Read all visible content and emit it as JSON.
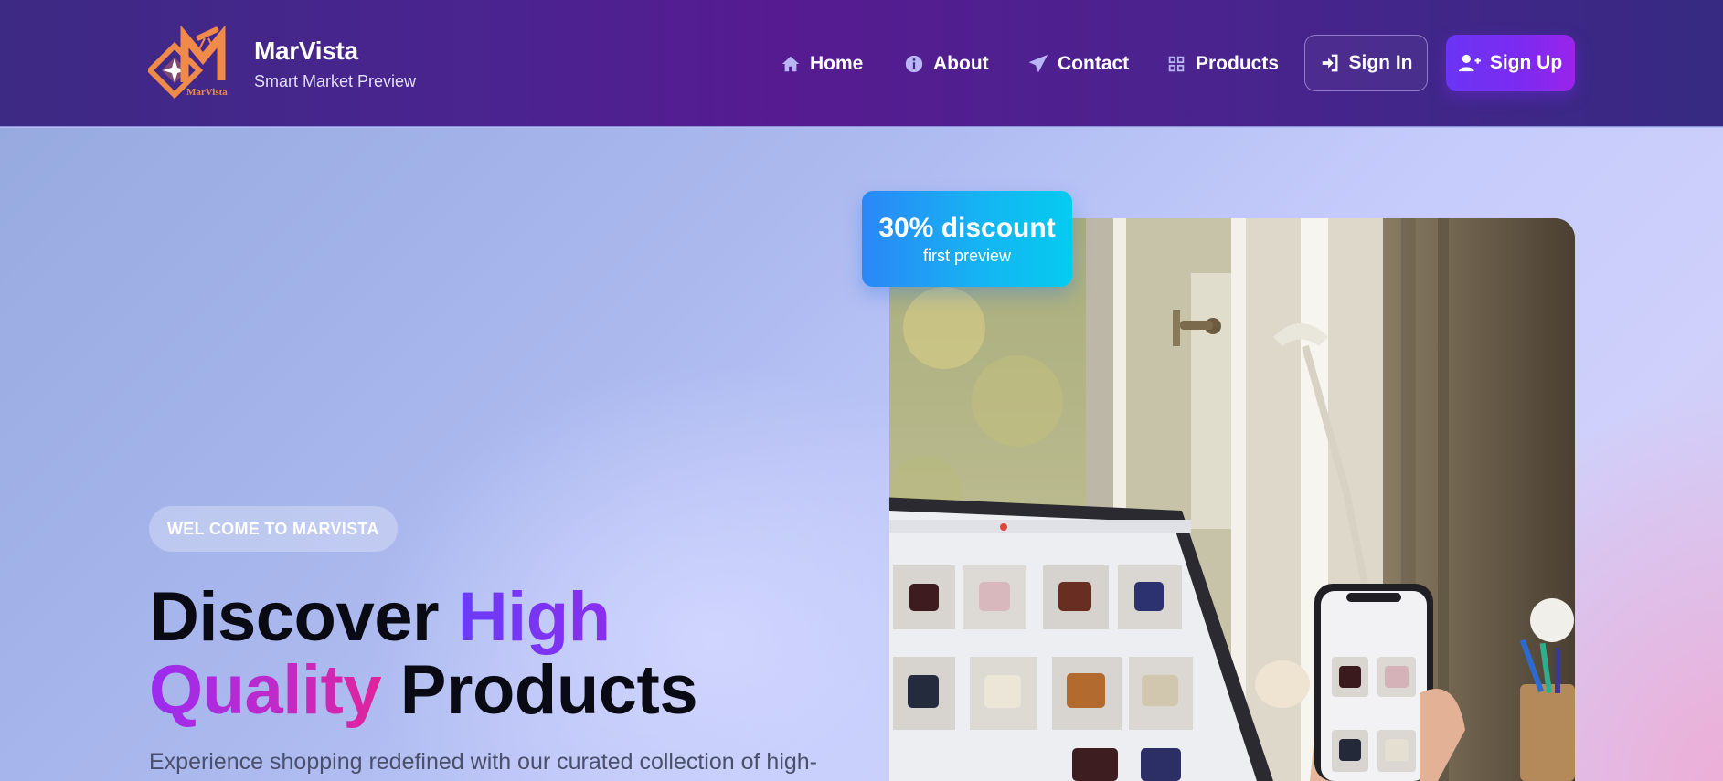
{
  "brand": {
    "name": "MarVista",
    "tagline": "Smart Market Preview",
    "logo_text": "MarVista"
  },
  "nav": {
    "home": "Home",
    "about": "About",
    "contact": "Contact",
    "products": "Products",
    "sign_in": "Sign In",
    "sign_up": "Sign Up"
  },
  "hero": {
    "welcome": "WEL COME TO MARVISTA",
    "headline_1": "Discover ",
    "headline_2": "High",
    "headline_3": "Quality",
    "headline_4": " Products",
    "subtext": "Experience shopping redefined with our curated collection of high-"
  },
  "promo": {
    "title": "30% discount",
    "subtitle": "first preview"
  },
  "colors": {
    "accent": "#6a35f5",
    "header_bg": "#4b2390",
    "promo": "#14b6f2",
    "logo": "#f08a4b"
  },
  "icons": [
    "home-icon",
    "info-icon",
    "paper-plane-icon",
    "grid-icon",
    "sign-in-icon",
    "user-plus-icon"
  ]
}
